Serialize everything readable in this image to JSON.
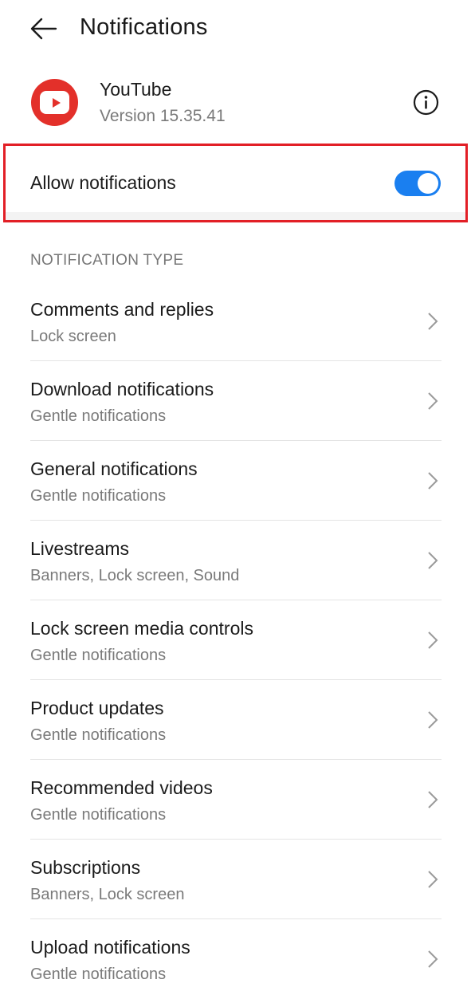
{
  "header": {
    "back_icon": "arrow-left-icon",
    "title": "Notifications"
  },
  "app": {
    "icon": "youtube-logo-icon",
    "name": "YouTube",
    "version": "Version 15.35.41",
    "info_icon": "info-circle-icon"
  },
  "allow_notifications": {
    "label": "Allow notifications",
    "enabled": true,
    "toggle_color": "#1a7ff0",
    "highlight_color": "#e21f26"
  },
  "section": {
    "title": "NOTIFICATION TYPE"
  },
  "items": [
    {
      "title": "Comments and replies",
      "subtitle": "Lock screen"
    },
    {
      "title": "Download notifications",
      "subtitle": "Gentle notifications"
    },
    {
      "title": "General notifications",
      "subtitle": "Gentle notifications"
    },
    {
      "title": "Livestreams",
      "subtitle": "Banners, Lock screen, Sound"
    },
    {
      "title": "Lock screen media controls",
      "subtitle": "Gentle notifications"
    },
    {
      "title": "Product updates",
      "subtitle": "Gentle notifications"
    },
    {
      "title": "Recommended videos",
      "subtitle": "Gentle notifications"
    },
    {
      "title": "Subscriptions",
      "subtitle": "Banners, Lock screen"
    },
    {
      "title": "Upload notifications",
      "subtitle": "Gentle notifications"
    }
  ]
}
